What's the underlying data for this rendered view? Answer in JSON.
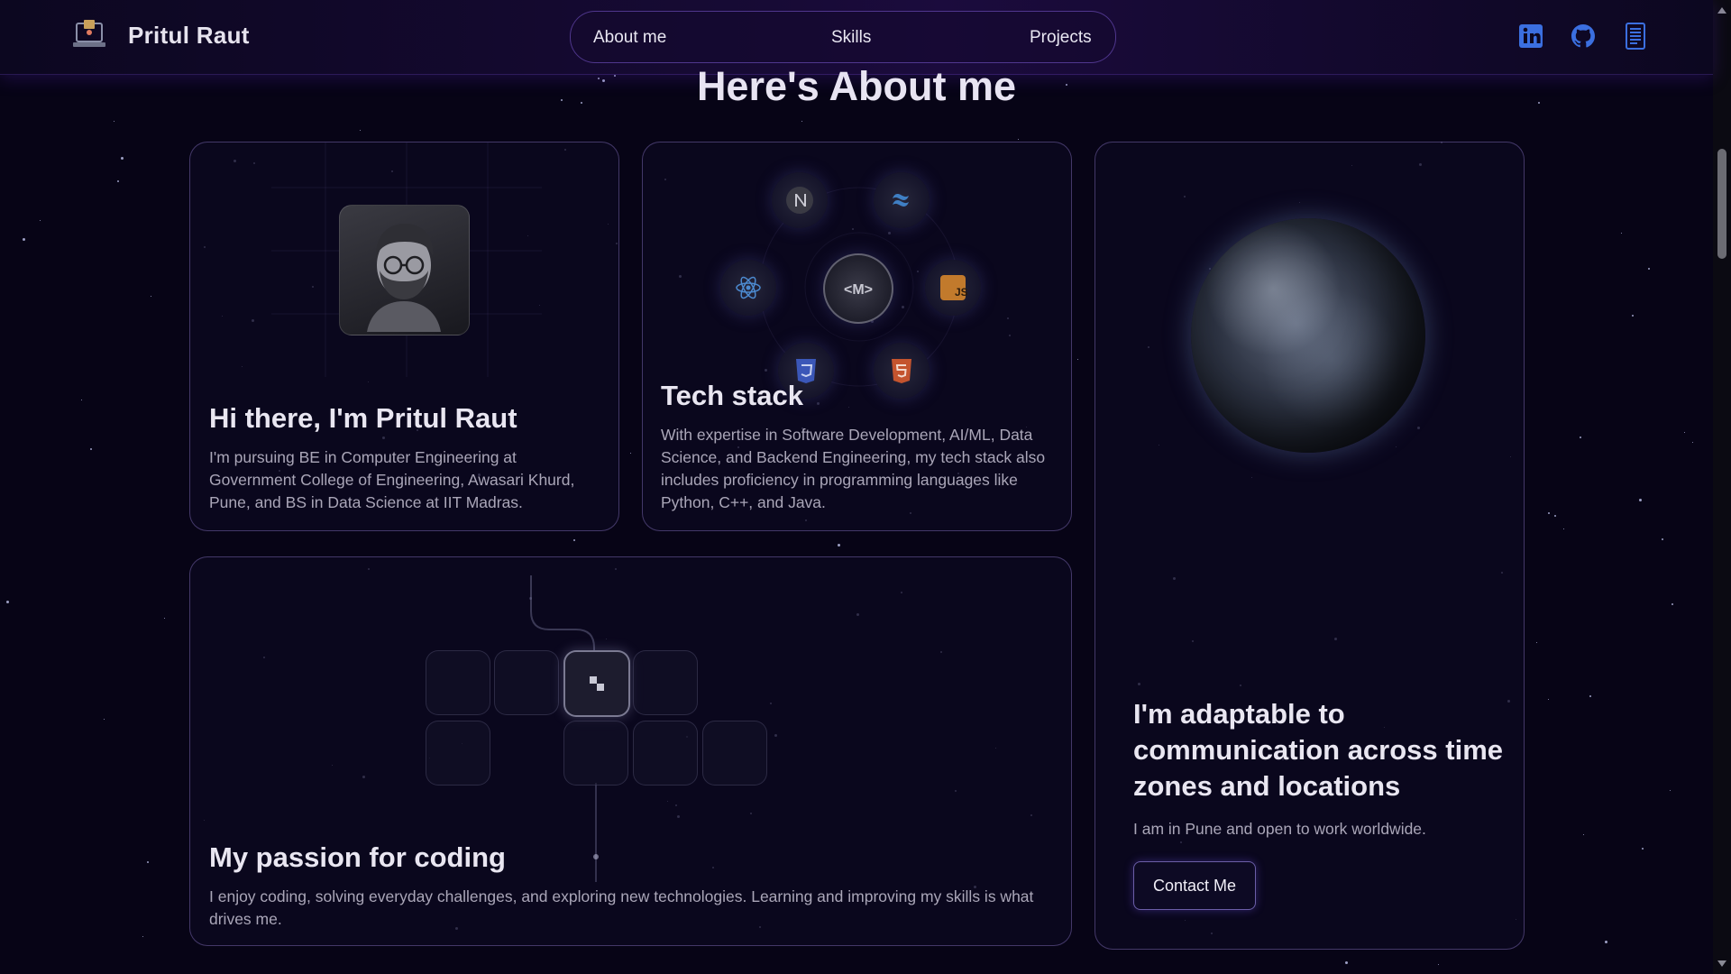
{
  "brand": {
    "name": "Pritul Raut",
    "logo_icon": "laptop-logo-icon"
  },
  "nav": {
    "links": [
      "About me",
      "Skills",
      "Projects"
    ]
  },
  "socials": [
    {
      "name": "linkedin",
      "icon": "linkedin-icon",
      "color": "#3b6fe0"
    },
    {
      "name": "github",
      "icon": "github-icon",
      "color": "#3b6fe0"
    },
    {
      "name": "resume",
      "icon": "document-icon",
      "color": "#3b6fe0"
    }
  ],
  "section": {
    "title": "Here's About me"
  },
  "cards": {
    "intro": {
      "title": "Hi there, I'm Pritul Raut",
      "text": "I'm pursuing BE in Computer Engineering at Government College of Engineering, Awasari Khurd, Pune, and BS in Data Science at IIT Madras."
    },
    "tech": {
      "title": "Tech stack",
      "text": "With expertise in Software Development, AI/ML, Data Science, and Backend Engineering, my tech stack also includes proficiency in programming languages like Python, C++, and Java.",
      "icons": [
        "nextjs-icon",
        "tailwind-icon",
        "react-icon",
        "my-logo-icon",
        "javascript-icon",
        "css3-icon",
        "html5-icon"
      ]
    },
    "location": {
      "title": "I'm adaptable to communication across time zones and locations",
      "text": "I am in Pune and open to work worldwide.",
      "button": "Contact Me"
    },
    "passion": {
      "title": "My passion for coding",
      "text": "I enjoy coding, solving everyday challenges, and exploring new technologies. Learning and improving my skills is what drives me."
    }
  },
  "colors": {
    "background": "#070416",
    "accent": "#7c5cff",
    "icon_blue": "#3b6fe0"
  }
}
